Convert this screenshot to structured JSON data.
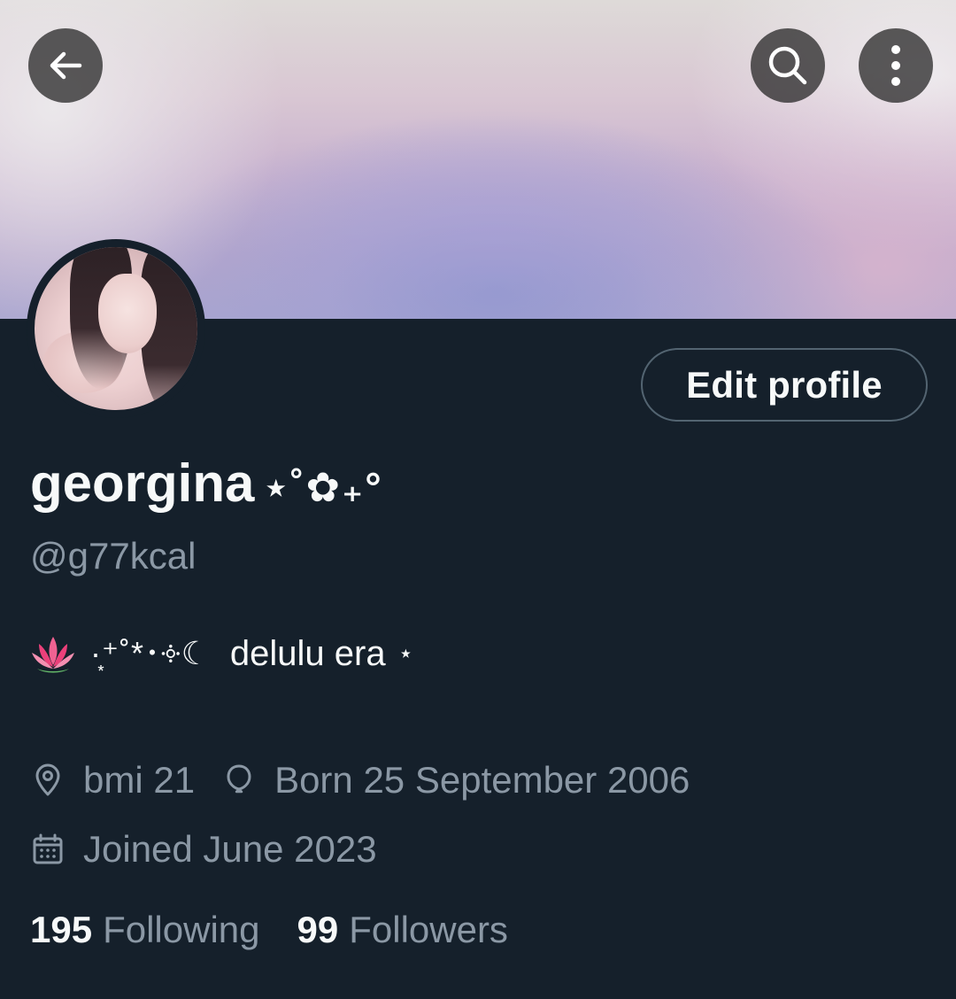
{
  "header": {
    "icons": {
      "back": "arrow-left-icon",
      "search": "search-icon",
      "more": "more-vertical-icon"
    }
  },
  "profile": {
    "display_name": "georgina",
    "display_name_deco": "⋆˚✿₊°",
    "handle": "@g77kcal",
    "edit_button_label": "Edit profile",
    "bio": {
      "emoji": "lotus-emoji",
      "decoration": "·͙⁺˚*･༓☾",
      "text": "delulu era",
      "trailing": "⋆"
    },
    "location": "bmi 21",
    "birthday": "Born 25 September 2006",
    "joined": "Joined June 2023",
    "following_count": "195",
    "following_label": "Following",
    "followers_count": "99",
    "followers_label": "Followers"
  },
  "colors": {
    "background": "#15202b",
    "primary_text": "#f7f9f9",
    "secondary_text": "#8b98a5",
    "button_border": "#536471"
  }
}
